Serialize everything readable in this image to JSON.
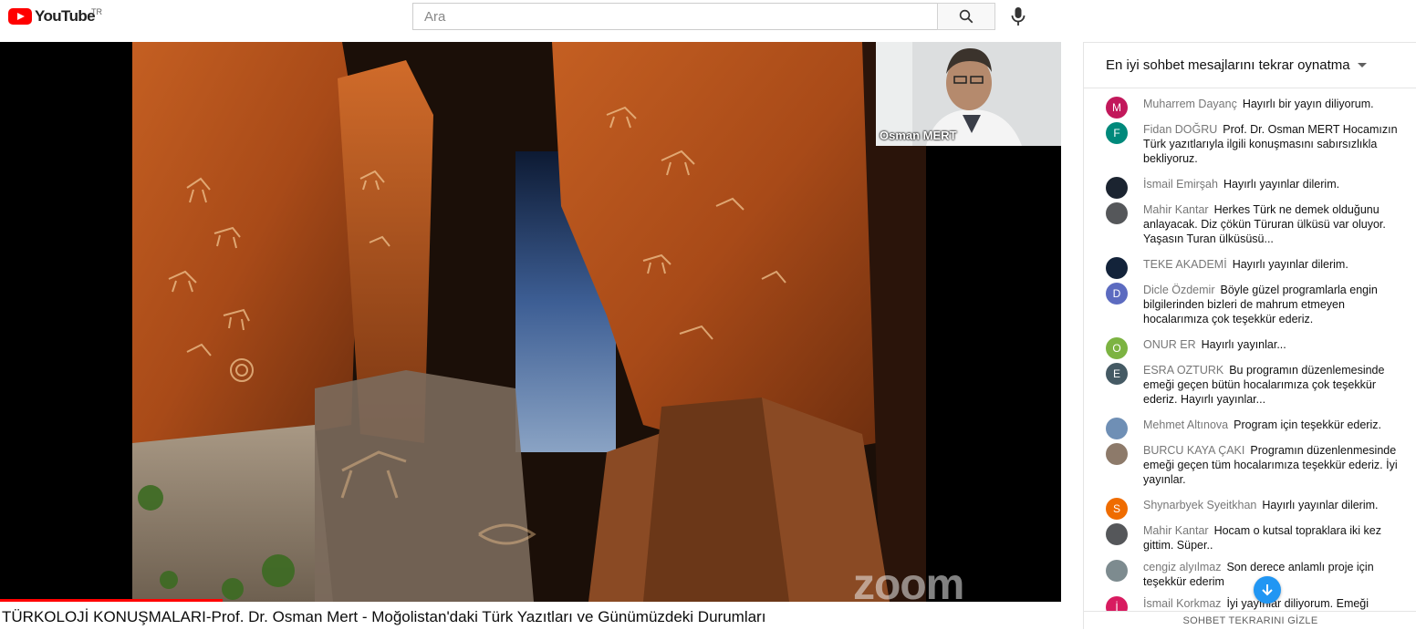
{
  "masthead": {
    "logo_text": "YouTube",
    "country_code": "TR",
    "search_placeholder": "Ara",
    "icons": {
      "search": "search-icon",
      "mic": "microphone-icon"
    }
  },
  "player": {
    "speaker_name": "Osman MERT",
    "watermark": "zoom",
    "progress_fraction": 0.21
  },
  "video": {
    "title": "TÜRKOLOJİ KONUŞMALARI-Prof. Dr. Osman Mert - Moğolistan'daki Türk Yazıtları ve Günümüzdeki Durumları"
  },
  "chat": {
    "header_label": "En iyi sohbet mesajlarını tekrar oynatma",
    "footer_label": "SOHBET TEKRARINI GİZLE",
    "messages": [
      {
        "author": "Muharrem Dayanç",
        "text": "Hayırlı bir yayın diliyorum.",
        "initial": "M",
        "color": "#c2185b"
      },
      {
        "author": "Fidan DOĞRU",
        "text": "Prof. Dr. Osman MERT Hocamızın Türk yazıtlarıyla ilgili konuşmasını sabırsızlıkla bekliyoruz.",
        "initial": "F",
        "color": "#00897b"
      },
      {
        "author": "İsmail Emirşah",
        "text": "Hayırlı yayınlar dilerim.",
        "initial": "",
        "color": "#1b2430"
      },
      {
        "author": "Mahir Kantar",
        "text": "Herkes Türk ne demek olduğunu anlayacak. Diz çökün Türuran ülküsü var oluyor. Yaşasın Turan ülküsüsü...",
        "initial": "",
        "color": "#55575a"
      },
      {
        "author": "TEKE AKADEMİ",
        "text": "Hayırlı yayınlar dilerim.",
        "initial": "",
        "color": "#13233a"
      },
      {
        "author": "Dicle Özdemir",
        "text": "Böyle güzel programlarla engin bilgilerinden bizleri de mahrum etmeyen hocalarımıza çok teşekkür ederiz.",
        "initial": "D",
        "color": "#5c6bc0"
      },
      {
        "author": "ONUR ER",
        "text": "Hayırlı yayınlar...",
        "initial": "O",
        "color": "#7cb342"
      },
      {
        "author": "ESRA OZTURK",
        "text": "Bu programın düzenlemesinde emeği geçen bütün hocalarımıza çok teşekkür ederiz. Hayırlı yayınlar...",
        "initial": "E",
        "color": "#455a64"
      },
      {
        "author": "Mehmet Altınova",
        "text": "Program için teşekkür ederiz.",
        "initial": "",
        "color": "#6f8fb5"
      },
      {
        "author": "BURCU KAYA ÇAKI",
        "text": "Programın düzenlenmesinde emeği geçen tüm hocalarımıza teşekkür ederiz. İyi yayınlar.",
        "initial": "",
        "color": "#8d7a6a"
      },
      {
        "author": "Shynarbyek Syeitkhan",
        "text": "Hayırlı yayınlar dilerim.",
        "initial": "S",
        "color": "#ef6c00"
      },
      {
        "author": "Mahir Kantar",
        "text": "Hocam o kutsal topraklara iki kez gittim. Süper..",
        "initial": "",
        "color": "#55575a"
      },
      {
        "author": "cengiz alyılmaz",
        "text": "Son derece anlamlı proje için teşekkür ederim",
        "initial": "",
        "color": "#7d8b8f"
      },
      {
        "author": "İsmail Korkmaz",
        "text": "İyi yayınlar diliyorum. Emeği",
        "initial": "İ",
        "color": "#d81b60"
      }
    ]
  },
  "colors": {
    "accent": "#ff0000",
    "chat_author": "#777777",
    "scroll_button": "#2196f3"
  }
}
